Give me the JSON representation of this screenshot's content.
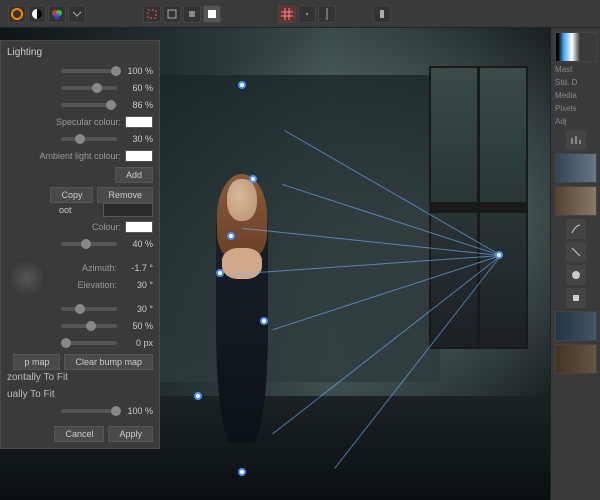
{
  "panel": {
    "title": "Lighting",
    "diffuse_pct": "100 %",
    "specular_pct": "60 %",
    "shininess_pct": "86 %",
    "spec_colour_label": "Specular colour:",
    "spec_opacity": "30 %",
    "ambient_label": "Ambient light colour:",
    "add": "Add",
    "copy": "Copy",
    "remove": "Remove",
    "type_value": "oot",
    "colour_label": "Colour:",
    "colour_pct": "40 %",
    "azimuth_label": "Azimuth:",
    "azimuth_val": "-1.7 °",
    "elevation_label": "Elevation:",
    "elevation_val": "30 °",
    "cone_val": "30 °",
    "falloff_val": "50 %",
    "distance_val": "0 px",
    "bumpmap": "p map",
    "clear_bump": "Clear bump map",
    "scale_fit": "zontally To Fit",
    "scale_auto": "ually To Fit",
    "scale_pct": "100 %",
    "cancel": "Cancel",
    "apply": "Apply"
  },
  "sidebar": {
    "meta1": "Mast",
    "meta2": "Std. D",
    "meta3": "Media",
    "meta4": "Pixels",
    "adjust_label": "Adj"
  },
  "toolbar": {
    "groups": [
      "swatches",
      "selection",
      "arrange",
      "grid",
      "filter"
    ]
  }
}
